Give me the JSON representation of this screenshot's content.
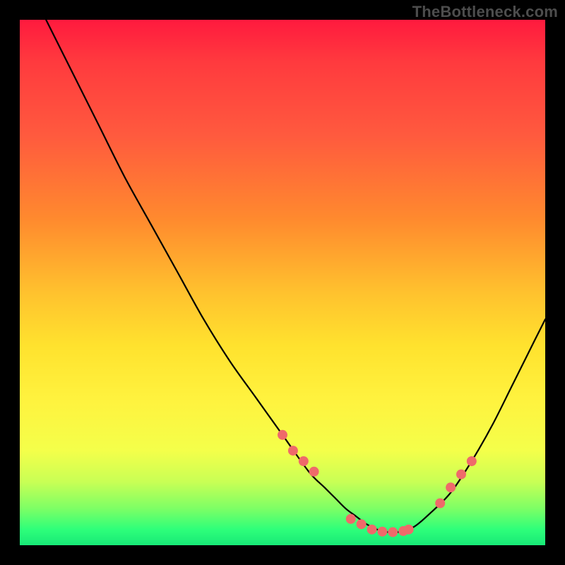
{
  "watermark": "TheBottleneck.com",
  "colors": {
    "background": "#000000",
    "curve": "#000000",
    "dots": "#ef6a6a",
    "watermark": "#4d4d4d"
  },
  "chart_data": {
    "type": "line",
    "title": "",
    "xlabel": "",
    "ylabel": "",
    "xlim": [
      0,
      100
    ],
    "ylim": [
      0,
      100
    ],
    "series": [
      {
        "name": "curve",
        "x": [
          5,
          10,
          15,
          20,
          25,
          30,
          35,
          40,
          45,
          50,
          55,
          58,
          60,
          62,
          64,
          66,
          68,
          70,
          72,
          75,
          78,
          82,
          86,
          90,
          94,
          98,
          100
        ],
        "y": [
          100,
          90,
          80,
          70,
          61,
          52,
          43,
          35,
          28,
          21,
          14,
          11,
          9,
          7,
          5.5,
          4,
          3,
          2.5,
          2.5,
          3.5,
          6,
          10,
          16,
          23,
          31,
          39,
          43
        ]
      }
    ],
    "dots": {
      "name": "highlight-dots",
      "x": [
        50,
        52,
        54,
        56,
        63,
        65,
        67,
        69,
        71,
        73,
        74,
        80,
        82,
        84,
        86
      ],
      "y": [
        21,
        18,
        16,
        14,
        5,
        4,
        3,
        2.6,
        2.5,
        2.7,
        3,
        8,
        11,
        13.5,
        16
      ]
    }
  }
}
